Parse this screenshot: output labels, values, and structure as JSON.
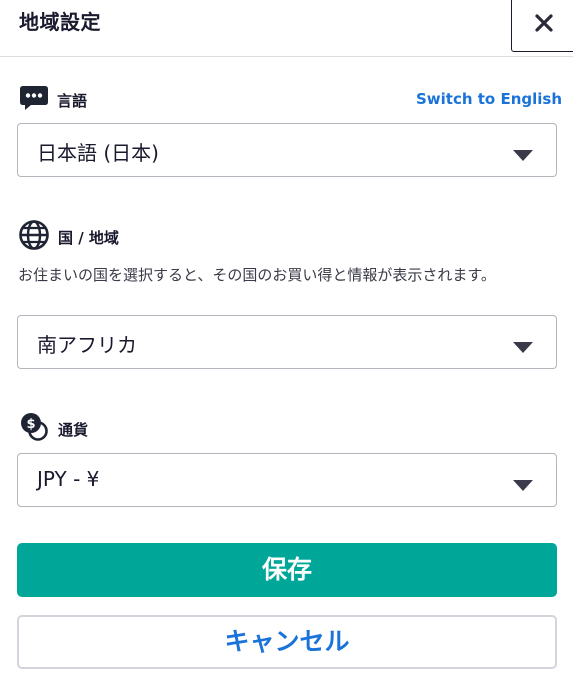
{
  "header": {
    "title": "地域設定",
    "close_icon": "close-icon"
  },
  "language": {
    "label": "言語",
    "icon": "chat-bubble-icon",
    "switch_link": "Switch to English",
    "selected": "日本語 (日本)"
  },
  "country": {
    "label": "国 / 地域",
    "icon": "globe-icon",
    "help_text": "お住まいの国を選択すると、その国のお買い得と情報が表示されます。",
    "selected": "南アフリカ"
  },
  "currency": {
    "label": "通貨",
    "icon": "coins-icon",
    "selected": "JPY - ¥"
  },
  "actions": {
    "save_label": "保存",
    "cancel_label": "キャンセル"
  },
  "colors": {
    "primary": "#00a698",
    "link": "#1a73d9",
    "text": "#1a1a2e",
    "border": "#b4b4bc"
  }
}
